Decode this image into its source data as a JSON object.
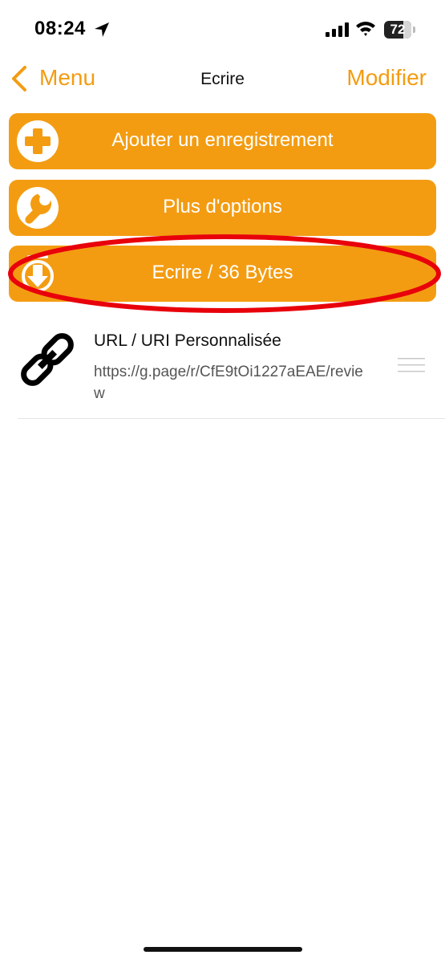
{
  "status_bar": {
    "time": "08:24",
    "battery": "72",
    "battery_level": 0.72,
    "icons": [
      "location-arrow-icon",
      "cellular-signal-icon",
      "wifi-icon",
      "battery-icon"
    ]
  },
  "nav": {
    "back_label": "Menu",
    "title": "Ecrire",
    "edit_label": "Modifier",
    "accent_color": "#f39c12"
  },
  "actions": {
    "add_label": "Ajouter un enregistrement",
    "options_label": "Plus d'options",
    "write_label": "Ecrire / 36 Bytes",
    "button_color": "#f39c12",
    "highlight_color": "#e8000b"
  },
  "records": [
    {
      "title": "URL / URI Personnalisée",
      "value": "https://g.page/r/CfE9tOi1227aEAE/review",
      "icon": "link-icon"
    }
  ]
}
